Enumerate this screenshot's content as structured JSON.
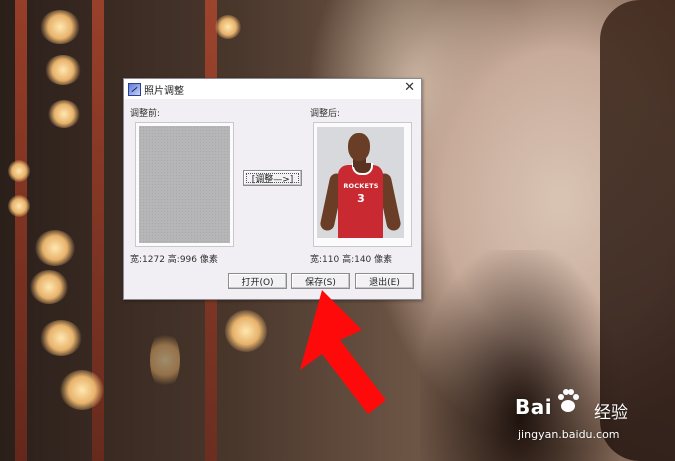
{
  "dialog": {
    "title": "照片调整",
    "close_symbol": "✕",
    "before_label": "调整前:",
    "after_label": "调整后:",
    "adjust_button": "[调整—>]",
    "before_size": "宽:1272 高:996 像素",
    "after_size": "宽:110 高:140 像素",
    "buttons": {
      "open": "打开(O)",
      "save": "保存(S)",
      "exit": "退出(E)"
    },
    "after_photo": {
      "jersey_text": "ROCKETS",
      "jersey_number": "3"
    }
  },
  "watermark": {
    "logo": "Bai",
    "logo_suffix": "经验",
    "url": "jingyan.baidu.com"
  },
  "colors": {
    "arrow": "#ff0a0a",
    "jersey": "#c92a32",
    "dialog_bg": "#f1eff3"
  },
  "icons": [
    "app-icon",
    "close-icon",
    "pointer-arrow-icon",
    "baidu-paw-icon"
  ]
}
